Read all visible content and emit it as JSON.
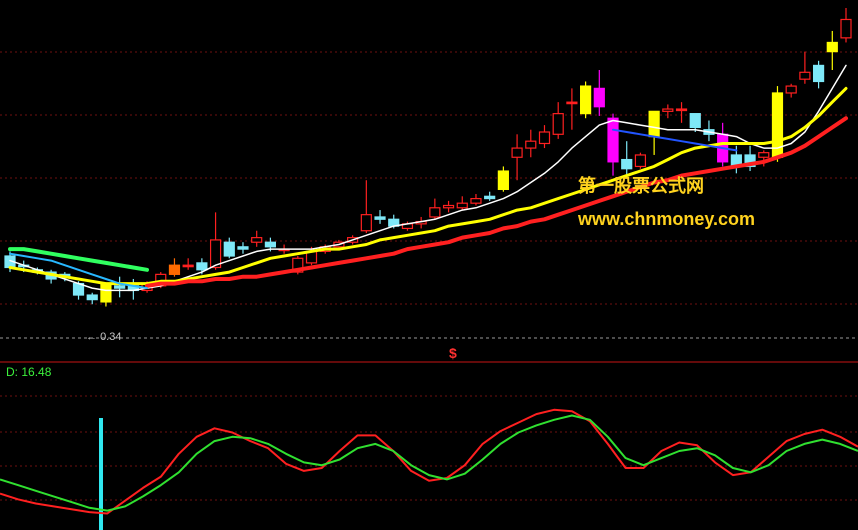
{
  "chart_data": [
    {
      "type": "candlestick",
      "ylim": [
        0,
        100
      ],
      "candles": [
        {
          "o": 27,
          "c": 22,
          "h": 29,
          "l": 20,
          "color": "#7ee8f8"
        },
        {
          "o": 23,
          "c": 23,
          "h": 25,
          "l": 20,
          "color": "#7ee8f8"
        },
        {
          "o": 21,
          "c": 20,
          "h": 22,
          "l": 19,
          "color": "#7ee8f8"
        },
        {
          "o": 20,
          "c": 17,
          "h": 21,
          "l": 15,
          "color": "#7ee8f8"
        },
        {
          "o": 19,
          "c": 18,
          "h": 20,
          "l": 16,
          "color": "#7ee8f8"
        },
        {
          "o": 15,
          "c": 10,
          "h": 16,
          "l": 8,
          "color": "#7ee8f8"
        },
        {
          "o": 10,
          "c": 8,
          "h": 11,
          "l": 6,
          "color": "#7ee8f8"
        },
        {
          "o": 15,
          "c": 7,
          "h": 15,
          "l": 5,
          "color": "#ffff00"
        },
        {
          "o": 14,
          "c": 13,
          "h": 18,
          "l": 9,
          "color": "#7ee8f8"
        },
        {
          "o": 14,
          "c": 12,
          "h": 17,
          "l": 8,
          "color": "#7ee8f8"
        },
        {
          "o": 12,
          "c": 15,
          "h": 16,
          "l": 11,
          "color": "#ff2020"
        },
        {
          "o": 14,
          "c": 19,
          "h": 20,
          "l": 13,
          "color": "#ff2020"
        },
        {
          "o": 19,
          "c": 23,
          "h": 26,
          "l": 18,
          "color": "#ff6a00"
        },
        {
          "o": 23,
          "c": 23,
          "h": 26,
          "l": 21,
          "color": "#ff2020"
        },
        {
          "o": 24,
          "c": 21,
          "h": 26,
          "l": 19,
          "color": "#7ee8f8"
        },
        {
          "o": 22,
          "c": 34,
          "h": 46,
          "l": 21,
          "color": "#ff2020"
        },
        {
          "o": 33,
          "c": 27,
          "h": 35,
          "l": 26,
          "color": "#7ee8f8"
        },
        {
          "o": 31,
          "c": 30,
          "h": 33,
          "l": 28,
          "color": "#7ee8f8"
        },
        {
          "o": 33,
          "c": 35,
          "h": 38,
          "l": 31,
          "color": "#ff2020"
        },
        {
          "o": 33,
          "c": 31,
          "h": 35,
          "l": 29,
          "color": "#7ee8f8"
        },
        {
          "o": 30,
          "c": 30,
          "h": 32,
          "l": 28,
          "color": "#ff2020"
        },
        {
          "o": 20,
          "c": 26,
          "h": 27,
          "l": 19,
          "color": "#ff2020"
        },
        {
          "o": 24,
          "c": 29,
          "h": 31,
          "l": 23,
          "color": "#ff2020"
        },
        {
          "o": 29,
          "c": 31,
          "h": 32,
          "l": 28,
          "color": "#ff2020"
        },
        {
          "o": 31,
          "c": 33,
          "h": 34,
          "l": 30,
          "color": "#ff2020"
        },
        {
          "o": 33,
          "c": 35,
          "h": 36,
          "l": 32,
          "color": "#ff2020"
        },
        {
          "o": 38,
          "c": 45,
          "h": 60,
          "l": 37,
          "color": "#ff2020"
        },
        {
          "o": 44,
          "c": 43,
          "h": 47,
          "l": 41,
          "color": "#7ee8f8"
        },
        {
          "o": 43,
          "c": 40,
          "h": 45,
          "l": 39,
          "color": "#7ee8f8"
        },
        {
          "o": 39,
          "c": 41,
          "h": 42,
          "l": 38,
          "color": "#ff2020"
        },
        {
          "o": 41,
          "c": 42,
          "h": 44,
          "l": 39,
          "color": "#ff2020"
        },
        {
          "o": 44,
          "c": 48,
          "h": 52,
          "l": 43,
          "color": "#ff2020"
        },
        {
          "o": 48,
          "c": 49,
          "h": 51,
          "l": 46,
          "color": "#ff2020"
        },
        {
          "o": 48,
          "c": 50,
          "h": 53,
          "l": 47,
          "color": "#ff2020"
        },
        {
          "o": 50,
          "c": 52,
          "h": 54,
          "l": 49,
          "color": "#ff2020"
        },
        {
          "o": 52,
          "c": 53,
          "h": 55,
          "l": 51,
          "color": "#7ee8f8"
        },
        {
          "o": 56,
          "c": 64,
          "h": 66,
          "l": 55,
          "color": "#ffff00"
        },
        {
          "o": 70,
          "c": 74,
          "h": 80,
          "l": 60,
          "color": "#ff2020"
        },
        {
          "o": 74,
          "c": 77,
          "h": 82,
          "l": 70,
          "color": "#ff2020"
        },
        {
          "o": 76,
          "c": 81,
          "h": 84,
          "l": 74,
          "color": "#ff2020"
        },
        {
          "o": 80,
          "c": 89,
          "h": 94,
          "l": 78,
          "color": "#ff2020"
        },
        {
          "o": 94,
          "c": 94,
          "h": 100,
          "l": 82,
          "color": "#ff2020"
        },
        {
          "o": 101,
          "c": 89,
          "h": 103,
          "l": 87,
          "color": "#ffff00"
        },
        {
          "o": 100,
          "c": 92,
          "h": 108,
          "l": 88,
          "color": "#ff00ff"
        },
        {
          "o": 87,
          "c": 68,
          "h": 89,
          "l": 62,
          "color": "#ff00ff"
        },
        {
          "o": 69,
          "c": 65,
          "h": 77,
          "l": 62,
          "color": "#7ee8f8"
        },
        {
          "o": 66,
          "c": 71,
          "h": 72,
          "l": 65,
          "color": "#ff2020"
        },
        {
          "o": 79,
          "c": 90,
          "h": 90,
          "l": 71,
          "color": "#ffff00"
        },
        {
          "o": 90,
          "c": 91,
          "h": 93,
          "l": 87,
          "color": "#ff2020"
        },
        {
          "o": 91,
          "c": 91,
          "h": 94,
          "l": 85,
          "color": "#ff2020"
        },
        {
          "o": 89,
          "c": 83,
          "h": 89,
          "l": 81,
          "color": "#7ee8f8"
        },
        {
          "o": 82,
          "c": 80,
          "h": 86,
          "l": 77,
          "color": "#7ee8f8"
        },
        {
          "o": 80,
          "c": 68,
          "h": 85,
          "l": 66,
          "color": "#ff00ff"
        },
        {
          "o": 71,
          "c": 66,
          "h": 75,
          "l": 63,
          "color": "#7ee8f8"
        },
        {
          "o": 66,
          "c": 71,
          "h": 75,
          "l": 64,
          "color": "#7ee8f8"
        },
        {
          "o": 70,
          "c": 72,
          "h": 73,
          "l": 66,
          "color": "#ff2020"
        },
        {
          "o": 70,
          "c": 98,
          "h": 101,
          "l": 68,
          "color": "#ffff00"
        },
        {
          "o": 98,
          "c": 101,
          "h": 102,
          "l": 96,
          "color": "#ff2020"
        },
        {
          "o": 104,
          "c": 107,
          "h": 116,
          "l": 102,
          "color": "#ff2020"
        },
        {
          "o": 103,
          "c": 110,
          "h": 112,
          "l": 100,
          "color": "#7ee8f8"
        },
        {
          "o": 116,
          "c": 120,
          "h": 125,
          "l": 108,
          "color": "#ffff00"
        },
        {
          "o": 122,
          "c": 130,
          "h": 135,
          "l": 120,
          "color": "#ff2020"
        }
      ],
      "series": [
        {
          "color": "#ffffff",
          "values": [
            25,
            23,
            21,
            19,
            17,
            15,
            13,
            12,
            12,
            12,
            13,
            14,
            16,
            18,
            20,
            23,
            25,
            27,
            29,
            30,
            30,
            30,
            30,
            31,
            32,
            34,
            36,
            38,
            40,
            41,
            42,
            43,
            45,
            47,
            48,
            50,
            52,
            55,
            59,
            63,
            68,
            74,
            79,
            84,
            86,
            85,
            84,
            83,
            82,
            82,
            82,
            81,
            80,
            79,
            76,
            74,
            74,
            76,
            81,
            90,
            100,
            110
          ]
        },
        {
          "color": "#ffff00",
          "values": [
            22,
            21,
            20,
            19,
            18,
            17,
            16,
            15,
            15,
            15,
            15,
            16,
            16,
            17,
            18,
            19,
            20,
            22,
            24,
            26,
            27,
            28,
            29,
            30,
            30,
            31,
            32,
            34,
            35,
            36,
            37,
            38,
            40,
            41,
            42,
            43,
            45,
            47,
            48,
            50,
            52,
            54,
            56,
            58,
            60,
            62,
            64,
            66,
            69,
            72,
            74,
            75,
            76,
            76,
            76,
            76,
            77,
            79,
            83,
            88,
            94,
            100
          ]
        },
        {
          "color": "#ff2020",
          "values": [
            null,
            null,
            null,
            null,
            null,
            null,
            null,
            null,
            null,
            null,
            14,
            15,
            15,
            16,
            16,
            17,
            17,
            18,
            18,
            19,
            20,
            21,
            22,
            23,
            24,
            25,
            26,
            27,
            28,
            30,
            31,
            32,
            33,
            35,
            36,
            37,
            39,
            40,
            42,
            43,
            45,
            47,
            49,
            51,
            53,
            55,
            57,
            59,
            60,
            62,
            63,
            64,
            65,
            66,
            67,
            68,
            70,
            72,
            75,
            79,
            83,
            87
          ]
        },
        {
          "color": "#2255ff",
          "values": [
            null,
            null,
            null,
            null,
            null,
            null,
            null,
            null,
            null,
            null,
            null,
            null,
            null,
            null,
            null,
            null,
            null,
            null,
            null,
            null,
            null,
            null,
            null,
            null,
            null,
            null,
            null,
            null,
            null,
            null,
            null,
            null,
            null,
            null,
            null,
            null,
            null,
            null,
            null,
            null,
            null,
            null,
            null,
            null,
            82,
            81,
            80,
            79,
            78,
            77,
            76,
            75,
            74,
            73,
            null,
            null,
            null,
            null,
            null,
            null,
            null,
            null
          ]
        },
        {
          "color": "#30ff60",
          "values": [
            30,
            30,
            29,
            28,
            27,
            26,
            25,
            24,
            23,
            22,
            21,
            null,
            null,
            null,
            null,
            null,
            null,
            null,
            null,
            null,
            null,
            null,
            null,
            null,
            null,
            null,
            null,
            null,
            null,
            null,
            null,
            null,
            null,
            null,
            null,
            null,
            null,
            null,
            null,
            null,
            null,
            null,
            null,
            null,
            null,
            null,
            null,
            null,
            null,
            null,
            null,
            null,
            null,
            null,
            null,
            null,
            null,
            null,
            null,
            null,
            null,
            null
          ]
        },
        {
          "color": "#28b8ff",
          "values": [
            28,
            27,
            26,
            25,
            23,
            21,
            19,
            17,
            15,
            14,
            13,
            null,
            null,
            null,
            null,
            null,
            null,
            null,
            null,
            null,
            null,
            null,
            null,
            null,
            null,
            null,
            null,
            null,
            null,
            null,
            null,
            null,
            null,
            null,
            null,
            null,
            null,
            null,
            null,
            null,
            null,
            null,
            null,
            null,
            null,
            null,
            null,
            null,
            null,
            null,
            null,
            null,
            null,
            null,
            null,
            null,
            null,
            null,
            null,
            null,
            null,
            null
          ]
        }
      ],
      "annotations": {
        "low": "0.34",
        "signal": "$"
      },
      "watermark": [
        "第一股票公式网",
        "www.chnmoney.com"
      ]
    },
    {
      "type": "line",
      "ylim": [
        0,
        100
      ],
      "series": [
        {
          "name": "D",
          "color": "#30e030",
          "values": [
            30,
            26,
            22,
            18,
            14,
            10,
            8,
            11,
            18,
            26,
            35,
            48,
            57,
            60,
            59,
            55,
            48,
            42,
            40,
            44,
            52,
            55,
            50,
            40,
            33,
            30,
            34,
            44,
            55,
            63,
            68,
            72,
            75,
            72,
            60,
            45,
            40,
            45,
            50,
            52,
            47,
            38,
            35,
            40,
            50,
            55,
            58,
            55,
            50
          ]
        },
        {
          "name": "",
          "color": "#ff2020",
          "values": [
            20,
            16,
            13,
            11,
            9,
            7,
            6,
            15,
            24,
            32,
            48,
            60,
            66,
            63,
            57,
            52,
            41,
            36,
            38,
            50,
            61,
            61,
            50,
            36,
            29,
            31,
            40,
            55,
            64,
            70,
            76,
            79,
            78,
            71,
            55,
            38,
            38,
            50,
            56,
            54,
            42,
            33,
            35,
            46,
            57,
            62,
            65,
            60,
            53
          ]
        }
      ],
      "d_value": "16.48",
      "d_prefix": "D: ",
      "signal_bar_color": "#30e8f0"
    }
  ]
}
